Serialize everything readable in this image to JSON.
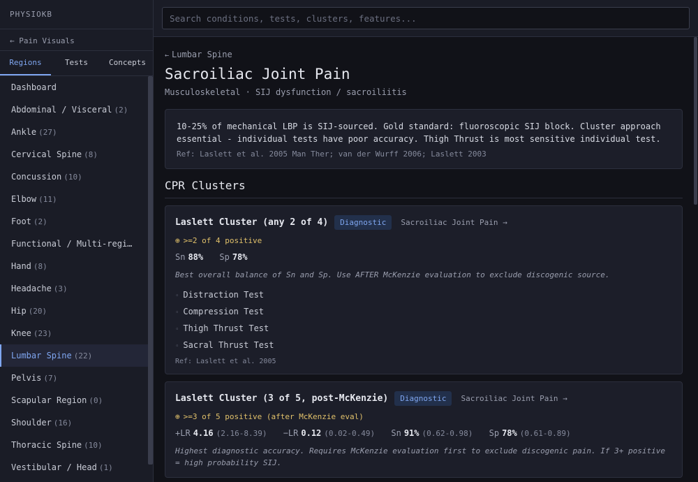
{
  "app": {
    "brand": "PHYSIOKB",
    "back_label": "← Pain Visuals"
  },
  "tabs": [
    {
      "label": "Regions",
      "active": true
    },
    {
      "label": "Tests",
      "active": false
    },
    {
      "label": "Concepts",
      "active": false
    }
  ],
  "regions": [
    {
      "name": "Dashboard",
      "count": ""
    },
    {
      "name": "Abdominal / Visceral",
      "count": "(2)"
    },
    {
      "name": "Ankle",
      "count": "(27)"
    },
    {
      "name": "Cervical Spine",
      "count": "(8)"
    },
    {
      "name": "Concussion",
      "count": "(10)"
    },
    {
      "name": "Elbow",
      "count": "(11)"
    },
    {
      "name": "Foot",
      "count": "(2)"
    },
    {
      "name": "Functional / Multi-regio…",
      "count": ""
    },
    {
      "name": "Hand",
      "count": "(8)"
    },
    {
      "name": "Headache",
      "count": "(3)"
    },
    {
      "name": "Hip",
      "count": "(20)"
    },
    {
      "name": "Knee",
      "count": "(23)"
    },
    {
      "name": "Lumbar Spine",
      "count": "(22)",
      "active": true
    },
    {
      "name": "Pelvis",
      "count": "(7)"
    },
    {
      "name": "Scapular Region",
      "count": "(0)"
    },
    {
      "name": "Shoulder",
      "count": "(16)"
    },
    {
      "name": "Thoracic Spine",
      "count": "(10)"
    },
    {
      "name": "Vestibular / Head",
      "count": "(1)"
    }
  ],
  "search": {
    "placeholder": "Search conditions, tests, clusters, features..."
  },
  "page": {
    "breadcrumb": "Lumbar Spine",
    "title": "Sacroiliac Joint Pain",
    "subtitle": "Musculoskeletal · SIJ dysfunction / sacroiliitis",
    "summary": "10-25% of mechanical LBP is SIJ-sourced. Gold standard: fluoroscopic SIJ block. Cluster approach essential - individual tests have poor accuracy. Thigh Thrust is most sensitive individual test.",
    "summary_ref": "Ref: Laslett et al. 2005 Man Ther; van der Wurff 2006; Laslett 2003",
    "section_title": "CPR Clusters"
  },
  "clusters": [
    {
      "title": "Laslett Cluster (any 2 of 4)",
      "badge": "Diagnostic",
      "link": "Sacroiliac Joint Pain →",
      "rule": ">=2 of 4 positive",
      "sn_label": "Sn",
      "sn": "88%",
      "sp_label": "Sp",
      "sp": "78%",
      "note": "Best overall balance of Sn and Sp. Use AFTER McKenzie evaluation to exclude discogenic source.",
      "tests": [
        "Distraction Test",
        "Compression Test",
        "Thigh Thrust Test",
        "Sacral Thrust Test"
      ],
      "ref": "Ref: Laslett et al. 2005"
    },
    {
      "title": "Laslett Cluster (3 of 5, post-McKenzie)",
      "badge": "Diagnostic",
      "link": "Sacroiliac Joint Pain →",
      "rule": ">=3 of 5 positive (after McKenzie eval)",
      "plr_label": "+LR",
      "plr": "4.16",
      "plr_ci": "(2.16-8.39)",
      "nlr_label": "−LR",
      "nlr": "0.12",
      "nlr_ci": "(0.02-0.49)",
      "sn_label": "Sn",
      "sn": "91%",
      "sn_ci": "(0.62-0.98)",
      "sp_label": "Sp",
      "sp": "78%",
      "sp_ci": "(0.61-0.89)",
      "note": "Highest diagnostic accuracy. Requires McKenzie evaluation first to exclude discogenic pain. If 3+ positive = high probability SIJ."
    }
  ],
  "icons": {
    "rule": "target-icon",
    "back": "left-arrow-icon",
    "bullet": "bullet-icon"
  },
  "colors": {
    "accent": "#7fa6f0",
    "rule": "#e0c06a",
    "badge_bg": "#22304b"
  }
}
